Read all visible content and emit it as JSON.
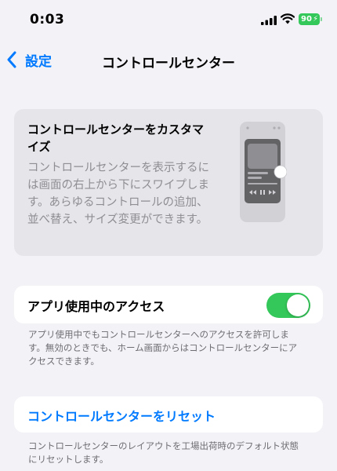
{
  "status_bar": {
    "time": "0:03",
    "battery": "90",
    "battery_color": "#34c759",
    "icons": [
      "cellular-signal-icon",
      "wifi-icon",
      "battery-charging-icon"
    ]
  },
  "nav": {
    "back_label": "設定",
    "title": "コントロールセンター",
    "accent": "#007aff"
  },
  "hero": {
    "title": "コントロールセンターをカスタマイズ",
    "description": "コントロールセンターを表示するには画面の右上から下にスワイプします。あらゆるコントロールの追加、並べ替え、サイズ変更ができます。",
    "illustration": "phone-swipe-illustration"
  },
  "access": {
    "label": "アプリ使用中のアクセス",
    "enabled": true,
    "toggle_color": "#34c759",
    "footnote": "アプリ使用中でもコントロールセンターへのアクセスを許可します。無効のときでも、ホーム画面からはコントロールセンターにアクセスできます。"
  },
  "reset": {
    "label": "コントロールセンターをリセット",
    "footnote": "コントロールセンターのレイアウトを工場出荷時のデフォルト状態にリセットします。"
  }
}
